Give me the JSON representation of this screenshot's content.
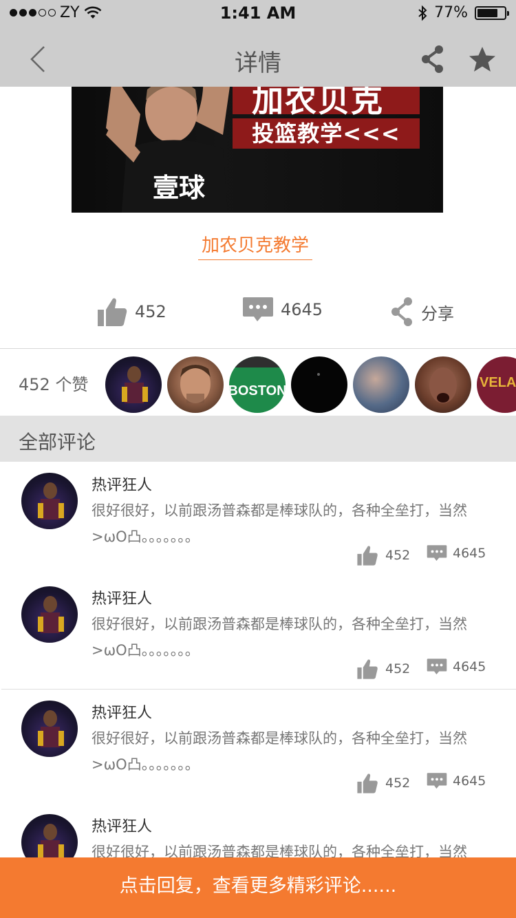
{
  "status_bar": {
    "carrier": "ZY",
    "time": "1:41 AM",
    "battery_percent": "77%",
    "battery_level": 0.77,
    "signal_icon": "signal-dots-icon",
    "wifi_icon": "wifi-icon",
    "bluetooth_icon": "bluetooth-icon"
  },
  "nav": {
    "title": "详情",
    "back_icon": "chevron-left-icon",
    "share_icon": "share-icon",
    "favorite_icon": "star-icon"
  },
  "video": {
    "banner_text_top": "加农贝克",
    "banner_text_sub": "投篮教学<<<",
    "banner_shirt_text": "壹球",
    "title": "加农贝克教学"
  },
  "actions": {
    "like_count": "452",
    "comment_count": "4645",
    "share_label": "分享"
  },
  "likes": {
    "summary": "452 个赞",
    "avatars": [
      "avatar-1",
      "avatar-2",
      "avatar-3",
      "avatar-4",
      "avatar-5",
      "avatar-6",
      "avatar-7"
    ],
    "avatar3_text": "BOSTON",
    "avatar7_text": "VELAN"
  },
  "comments_header": "全部评论",
  "comments": [
    {
      "user": "热评狂人",
      "text": "很好很好，以前跟汤普森都是棒球队的，各种全垒打，当然>ωO凸。。。。。。。",
      "likes": "452",
      "replies": "4645"
    },
    {
      "user": "热评狂人",
      "text": "很好很好，以前跟汤普森都是棒球队的，各种全垒打，当然>ωO凸。。。。。。。",
      "likes": "452",
      "replies": "4645"
    },
    {
      "user": "热评狂人",
      "text": "很好很好，以前跟汤普森都是棒球队的，各种全垒打，当然>ωO凸。。。。。。。",
      "likes": "452",
      "replies": "4645"
    },
    {
      "user": "热评狂人",
      "text": "很好很好，以前跟汤普森都是棒球队的，各种全垒打，当然",
      "likes": "",
      "replies": ""
    }
  ],
  "bottom_bar": {
    "label": "点击回复，查看更多精彩评论......"
  },
  "colors": {
    "accent": "#f47a30",
    "nav_bg": "#cdcdcd",
    "section_bg": "#e2e2e2"
  }
}
